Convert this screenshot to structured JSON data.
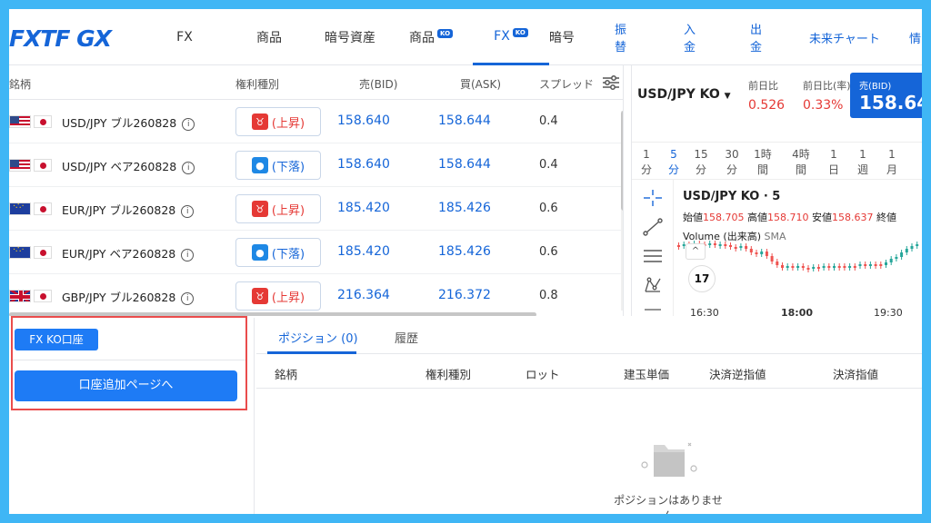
{
  "header": {
    "logo": "FXTF GX",
    "nav_tabs": [
      {
        "label": "FX",
        "badge": ""
      },
      {
        "label": "商品",
        "badge": ""
      },
      {
        "label": "暗号資産",
        "badge": ""
      },
      {
        "label": "商品",
        "badge": "KO"
      },
      {
        "label": "FX",
        "badge": "KO"
      },
      {
        "label": "暗号",
        "badge": ""
      }
    ],
    "links": [
      "振替",
      "入金",
      "出金",
      "未来チャート",
      "情"
    ]
  },
  "table": {
    "columns": {
      "symbol": "銘柄",
      "type": "権利種別",
      "bid": "売(BID)",
      "ask": "買(ASK)",
      "spread": "スプレッド"
    },
    "rows": [
      {
        "flags": [
          "us",
          "jp"
        ],
        "symbol": "USD/JPY ブル260828",
        "type": "(上昇)",
        "kind": "bull",
        "bid": "158.640",
        "ask": "158.644",
        "spread": "0.4"
      },
      {
        "flags": [
          "us",
          "jp"
        ],
        "symbol": "USD/JPY ベア260828",
        "type": "(下落)",
        "kind": "bear",
        "bid": "158.640",
        "ask": "158.644",
        "spread": "0.4"
      },
      {
        "flags": [
          "eu",
          "jp"
        ],
        "symbol": "EUR/JPY ブル260828",
        "type": "(上昇)",
        "kind": "bull",
        "bid": "185.420",
        "ask": "185.426",
        "spread": "0.6"
      },
      {
        "flags": [
          "eu",
          "jp"
        ],
        "symbol": "EUR/JPY ベア260828",
        "type": "(下落)",
        "kind": "bear",
        "bid": "185.420",
        "ask": "185.426",
        "spread": "0.6"
      },
      {
        "flags": [
          "gb",
          "jp"
        ],
        "symbol": "GBP/JPY ブル260828",
        "type": "(上昇)",
        "kind": "bull",
        "bid": "216.364",
        "ask": "216.372",
        "spread": "0.8"
      }
    ]
  },
  "chart_panel": {
    "pair": "USD/JPY KO",
    "prev_day_change_label": "前日比",
    "prev_day_change": "0.526",
    "prev_day_rate_label": "前日比(率)",
    "prev_day_rate": "0.33%",
    "sell_label": "売(BID)",
    "sell_value": "158.64",
    "timeframes": [
      {
        "top": "1",
        "bottom": "分"
      },
      {
        "top": "5",
        "bottom": "分"
      },
      {
        "top": "15",
        "bottom": "分"
      },
      {
        "top": "30",
        "bottom": "分"
      },
      {
        "top": "1時",
        "bottom": "間"
      },
      {
        "top": "4時",
        "bottom": "間"
      },
      {
        "top": "1",
        "bottom": "日"
      },
      {
        "top": "1",
        "bottom": "週"
      },
      {
        "top": "1",
        "bottom": "月"
      }
    ],
    "active_timeframe": 1,
    "chart_title": "USD/JPY KO · 5",
    "ohlc": {
      "open_label": "始値",
      "open": "158.705",
      "high_label": "高値",
      "high": "158.710",
      "low_label": "安値",
      "low": "158.637",
      "close_label": "終値"
    },
    "volume_label": "Volume (出来高)",
    "sma_label": "SMA",
    "x_axis": [
      "16:30",
      "18:00",
      "19:30"
    ],
    "colors": {
      "up": "#26a69a",
      "down": "#ef5350"
    }
  },
  "account": {
    "tag": "FX KO口座",
    "add_button": "口座追加ページへ"
  },
  "positions": {
    "tabs": [
      "ポジション (0)",
      "履歴"
    ],
    "columns": [
      "銘柄",
      "権利種別",
      "ロット",
      "建玉単価",
      "決済逆指値",
      "決済指値"
    ],
    "empty_text": "ポジションはありません"
  }
}
